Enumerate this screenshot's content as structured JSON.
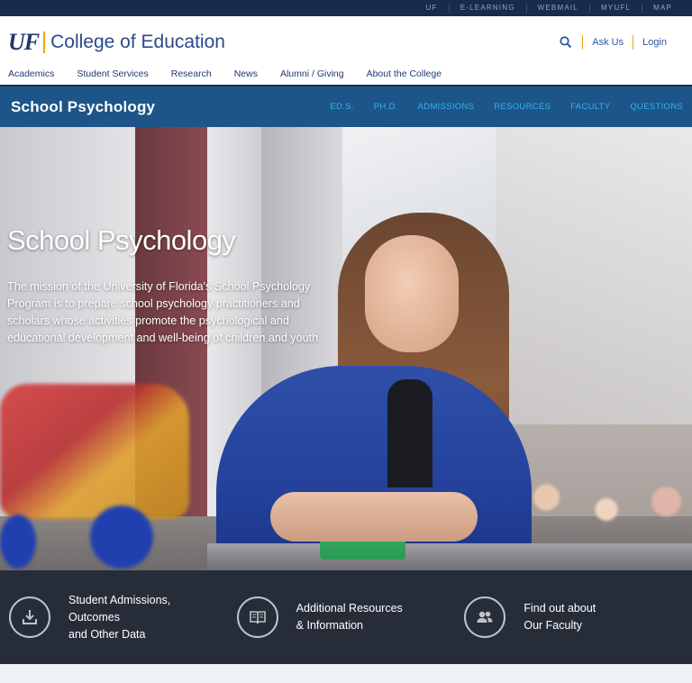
{
  "topbar": {
    "links": [
      "UF",
      "E-LEARNING",
      "WEBMAIL",
      "MYUFL",
      "MAP"
    ]
  },
  "header": {
    "logo_text": "UF",
    "college_name": "College of Education",
    "search_icon": "search-icon",
    "ask_us": "Ask Us",
    "login": "Login"
  },
  "mainnav": {
    "items": [
      "Academics",
      "Student Services",
      "Research",
      "News",
      "Alumni / Giving",
      "About the College"
    ]
  },
  "subbar": {
    "title": "School Psychology",
    "links": [
      "ED.S.",
      "PH.D.",
      "ADMISSIONS",
      "RESOURCES",
      "FACULTY",
      "QUESTIONS"
    ]
  },
  "hero": {
    "title": "School Psychology",
    "lines": [
      "The mission of the University of Florida's School Psychology",
      "Program is to prepare school psychology practitioners and",
      "scholars whose activities promote the psychological and",
      "educational development and well-being of children and youth."
    ]
  },
  "features": [
    {
      "icon": "download-icon",
      "line1": "Student Admissions, Outcomes",
      "line2": "and Other Data"
    },
    {
      "icon": "book-icon",
      "line1": "Additional Resources",
      "line2": "& Information"
    },
    {
      "icon": "users-icon",
      "line1": "Find out about",
      "line2": "Our Faculty"
    }
  ],
  "colors": {
    "navy": "#172b4f",
    "subbar": "#1d5589",
    "accent": "#f3a01a",
    "link_blue": "#35b4ea",
    "feature_bg": "#262d38"
  }
}
